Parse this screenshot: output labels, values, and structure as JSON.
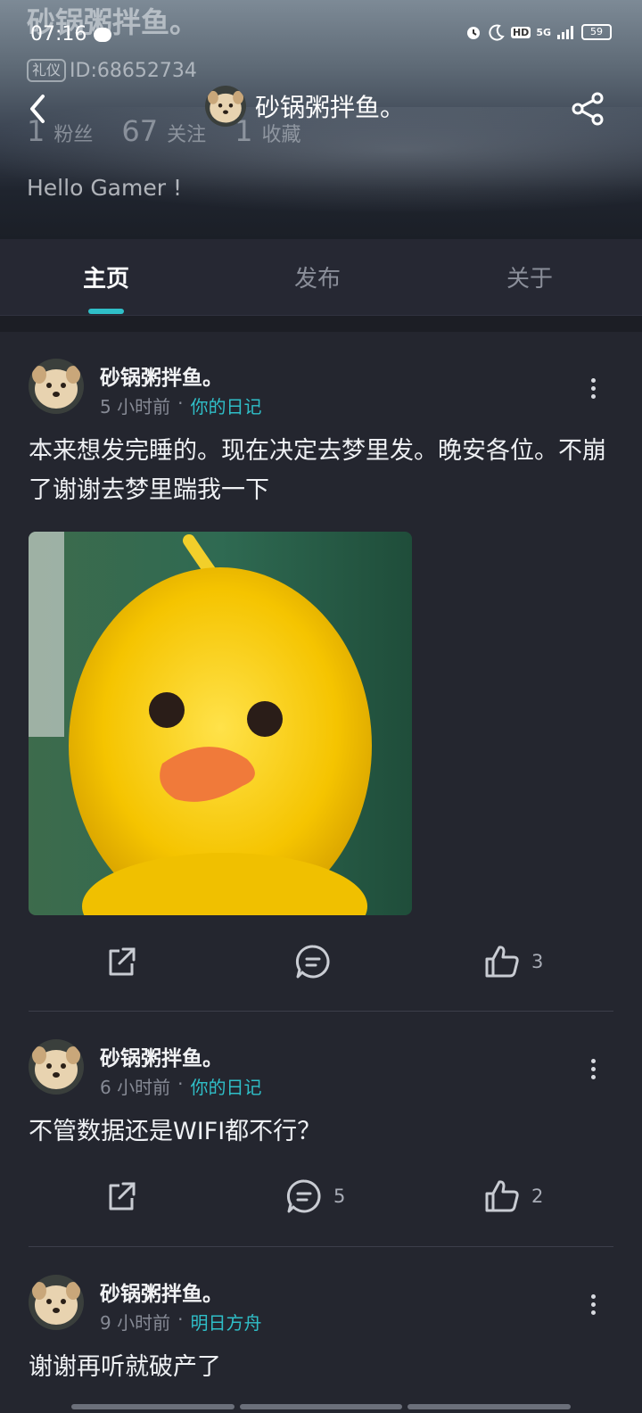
{
  "status_bar": {
    "time": "07:16",
    "network": "5G",
    "hd": "HD",
    "battery": "59"
  },
  "profile": {
    "name": "砂锅粥拌鱼。",
    "badge": "礼仪",
    "id": "ID:68652734",
    "fans_count": "1",
    "fans_label": "粉丝",
    "following_count": "67",
    "following_label": "关注",
    "favorites_count": "1",
    "favorites_label": "收藏",
    "bio": "Hello Gamer !"
  },
  "nav": {
    "title": "砂锅粥拌鱼。"
  },
  "tabs": [
    {
      "label": "主页",
      "active": true
    },
    {
      "label": "发布",
      "active": false
    },
    {
      "label": "关于",
      "active": false
    }
  ],
  "posts": [
    {
      "author": "砂锅粥拌鱼。",
      "time": "5 小时前",
      "topic": "你的日记",
      "text": "本来想发完睡的。现在决定去梦里发。晚安各位。不崩了谢谢去梦里踹我一下",
      "has_image": true,
      "comments": "",
      "likes": "3"
    },
    {
      "author": "砂锅粥拌鱼。",
      "time": "6 小时前",
      "topic": "你的日记",
      "text": "不管数据还是WIFI都不行？",
      "has_image": false,
      "comments": "5",
      "likes": "2"
    },
    {
      "author": "砂锅粥拌鱼。",
      "time": "9 小时前",
      "topic": "明日方舟",
      "text": "谢谢再听就破产了",
      "has_image": false,
      "comments": "",
      "likes": ""
    }
  ],
  "colors": {
    "accent": "#2fbfc8",
    "background": "#24262f"
  }
}
